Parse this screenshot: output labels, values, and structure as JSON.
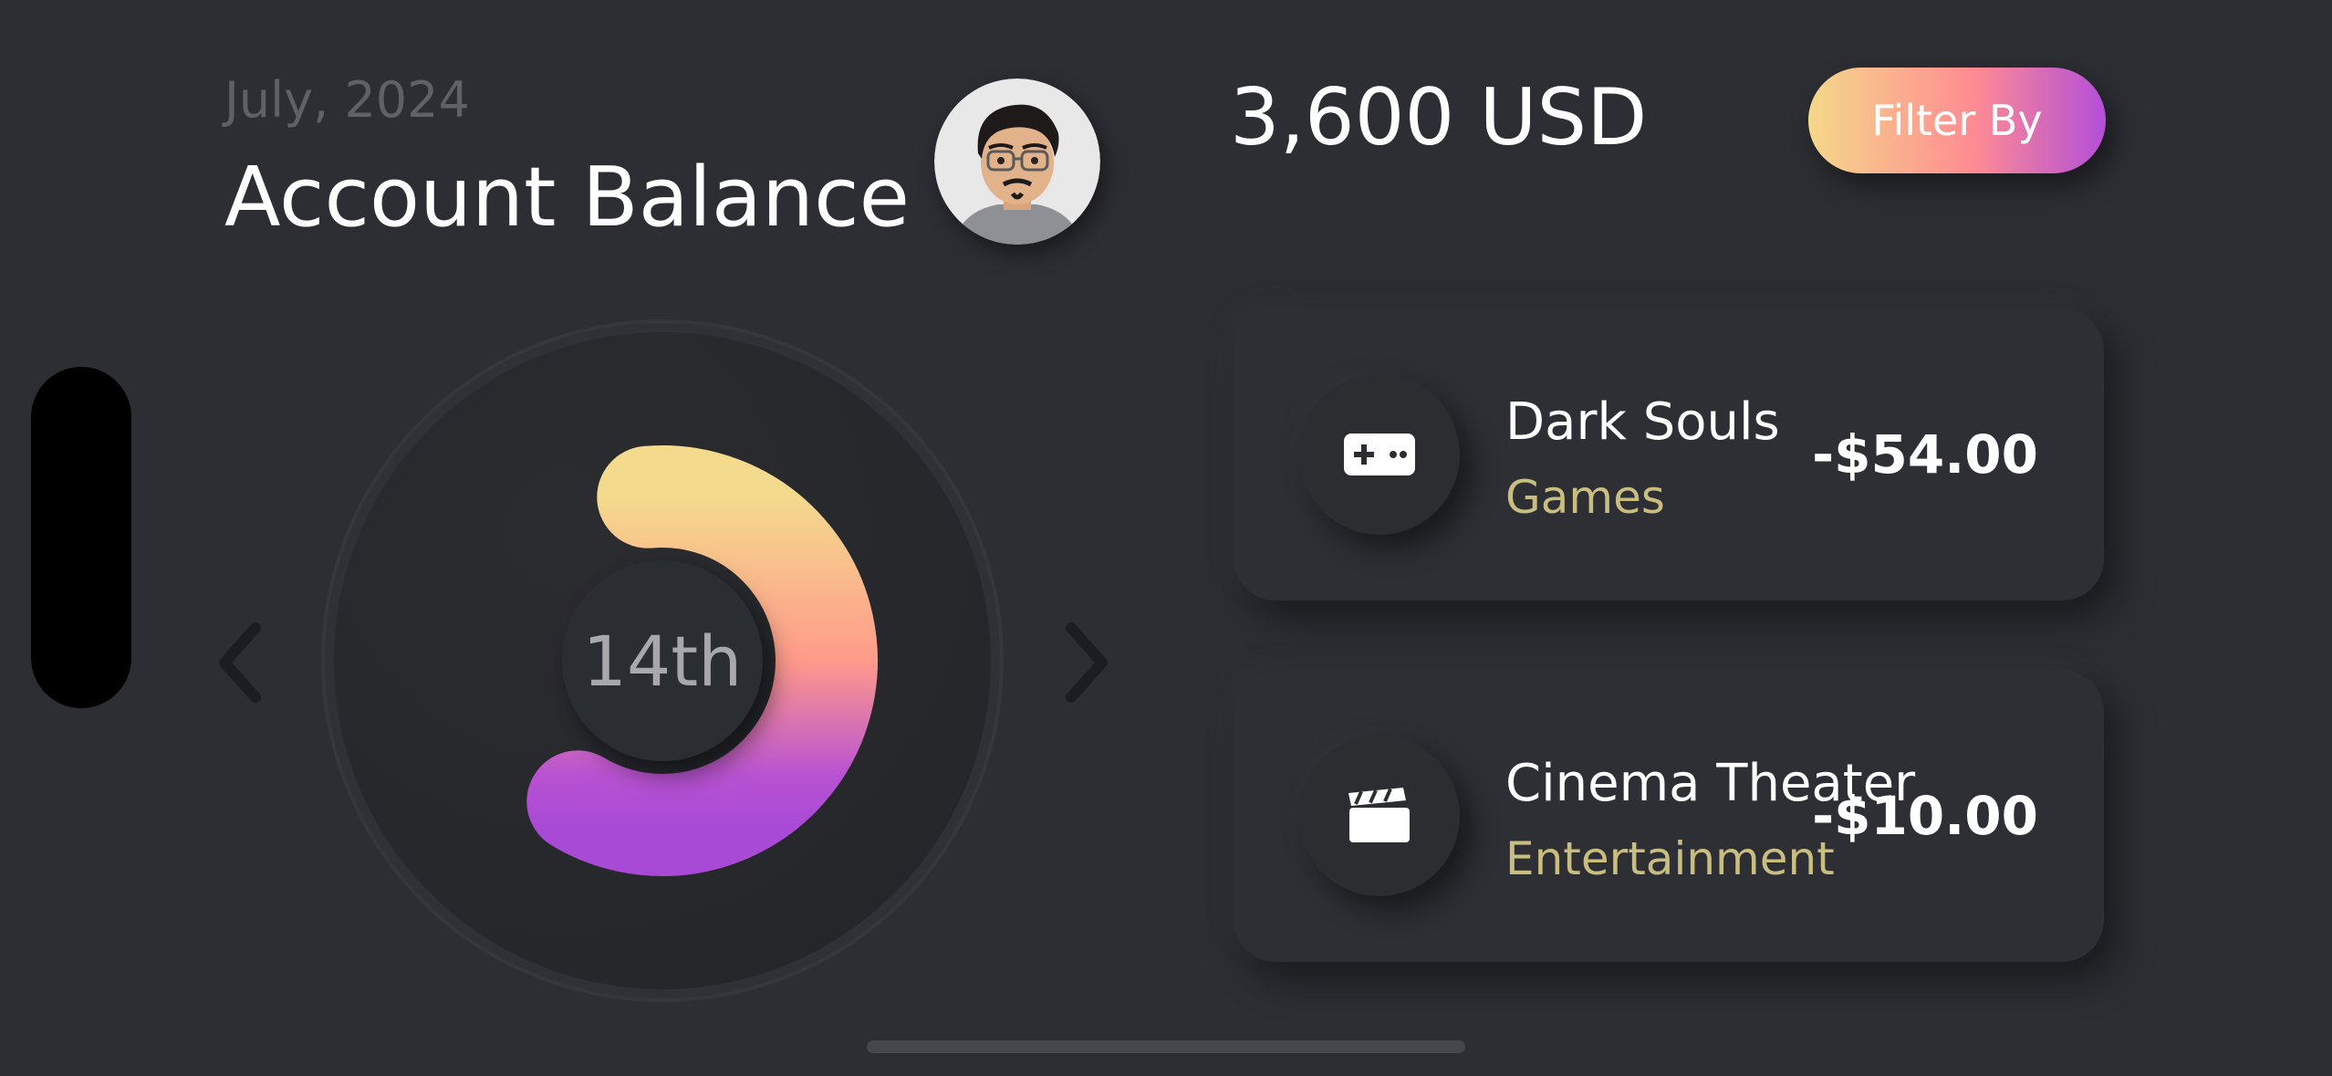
{
  "header": {
    "month_label": "July, 2024",
    "title": "Account Balance",
    "balance": "3,600 USD",
    "filter_label": "Filter By"
  },
  "chart": {
    "center_label": "14th",
    "progress_fraction": 0.6
  },
  "transactions": [
    {
      "title": "Dark Souls",
      "category": "Games",
      "amount": "-$54.00",
      "icon": "gamepad-icon"
    },
    {
      "title": "Cinema Theater",
      "category": "Entertainment",
      "amount": "-$10.00",
      "icon": "clapperboard-icon"
    }
  ],
  "colors": {
    "background": "#2c2e33",
    "accent_gradient": [
      "#f5d88a",
      "#ff8c92",
      "#b34fd9"
    ],
    "category_text": "#c9bd80"
  }
}
